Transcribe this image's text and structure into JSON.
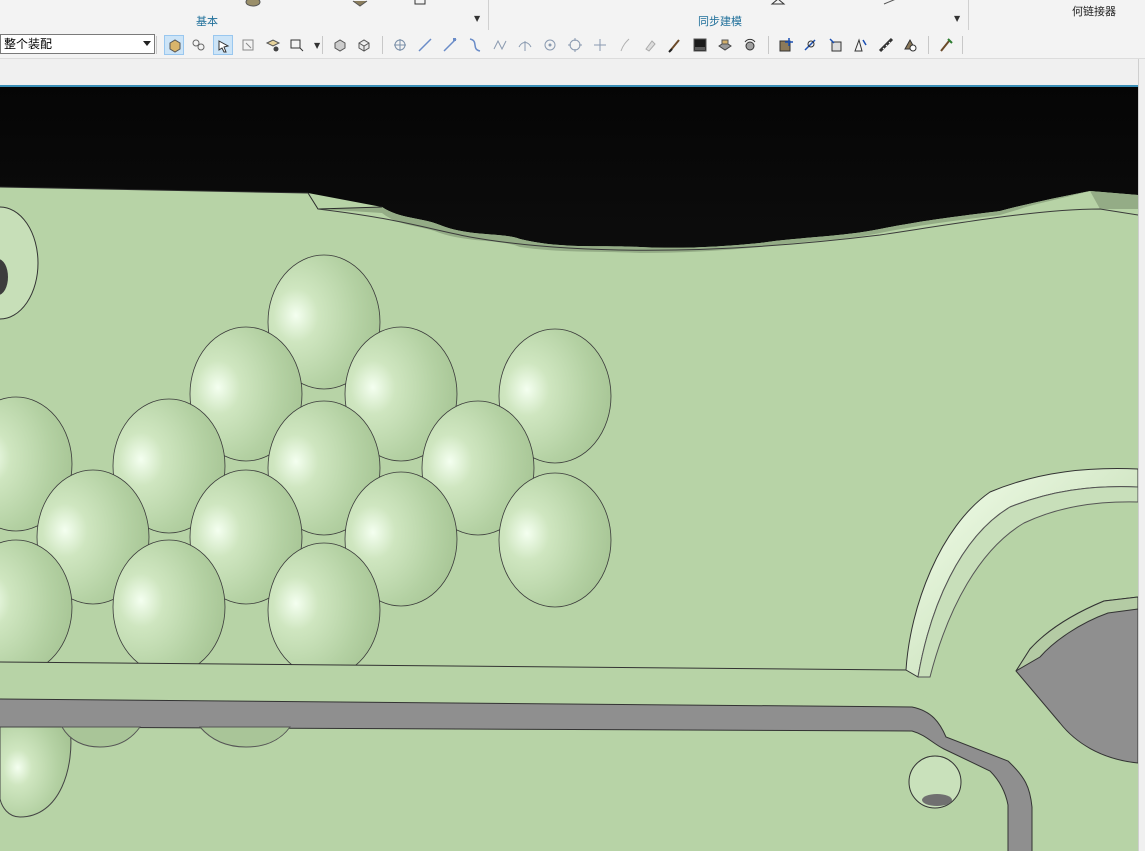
{
  "ribbon": {
    "groups": [
      {
        "label": "基本"
      },
      {
        "label": "同步建模"
      }
    ],
    "right_button_label": "何链接器"
  },
  "toolbar": {
    "filter": {
      "value": "整个装配"
    },
    "buttons": [
      {
        "name": "select-features-icon",
        "active": true
      },
      {
        "name": "select-components-icon",
        "active": false
      },
      {
        "name": "select-faces-icon",
        "active": true
      },
      {
        "name": "select-bodies-icon",
        "active": false
      },
      {
        "name": "select-feature-faces-icon",
        "active": false
      },
      {
        "name": "select-box-icon",
        "active": false
      },
      {
        "name": "shaded-view-icon",
        "active": false
      },
      {
        "name": "wireframe-view-icon",
        "active": false
      },
      {
        "name": "snap-point-icon",
        "active": false
      },
      {
        "name": "snap-line-icon",
        "active": false
      },
      {
        "name": "snap-endpoint-icon",
        "active": false
      },
      {
        "name": "snap-curve-icon",
        "active": false
      },
      {
        "name": "snap-control-point-icon",
        "active": false
      },
      {
        "name": "snap-intersection-icon",
        "active": false
      },
      {
        "name": "snap-center-icon",
        "active": false
      },
      {
        "name": "snap-quadrant-icon",
        "active": false
      },
      {
        "name": "snap-existing-point-icon",
        "active": false
      },
      {
        "name": "snap-on-curve-icon",
        "active": false
      },
      {
        "name": "snap-on-face-icon",
        "active": false
      },
      {
        "name": "brush-icon",
        "active": false
      },
      {
        "name": "screen-icon",
        "active": false
      },
      {
        "name": "edit-section-icon",
        "active": false
      },
      {
        "name": "rotate-part-icon",
        "active": false
      },
      {
        "name": "add-component-icon",
        "active": false
      },
      {
        "name": "move-component-icon",
        "active": false
      },
      {
        "name": "assembly-constraint-icon",
        "active": false
      },
      {
        "name": "show-constraints-icon",
        "active": false
      },
      {
        "name": "measure-icon",
        "active": false
      },
      {
        "name": "replace-component-icon",
        "active": false
      },
      {
        "name": "edit-object-display-icon",
        "active": false
      }
    ]
  },
  "viewport": {
    "background_top": "#050505",
    "background_bottom": "#2a2a2a",
    "face_color": "#b7d3a6",
    "highlight_color": "#eaffdf",
    "wall_color": "#8f8f8f"
  }
}
